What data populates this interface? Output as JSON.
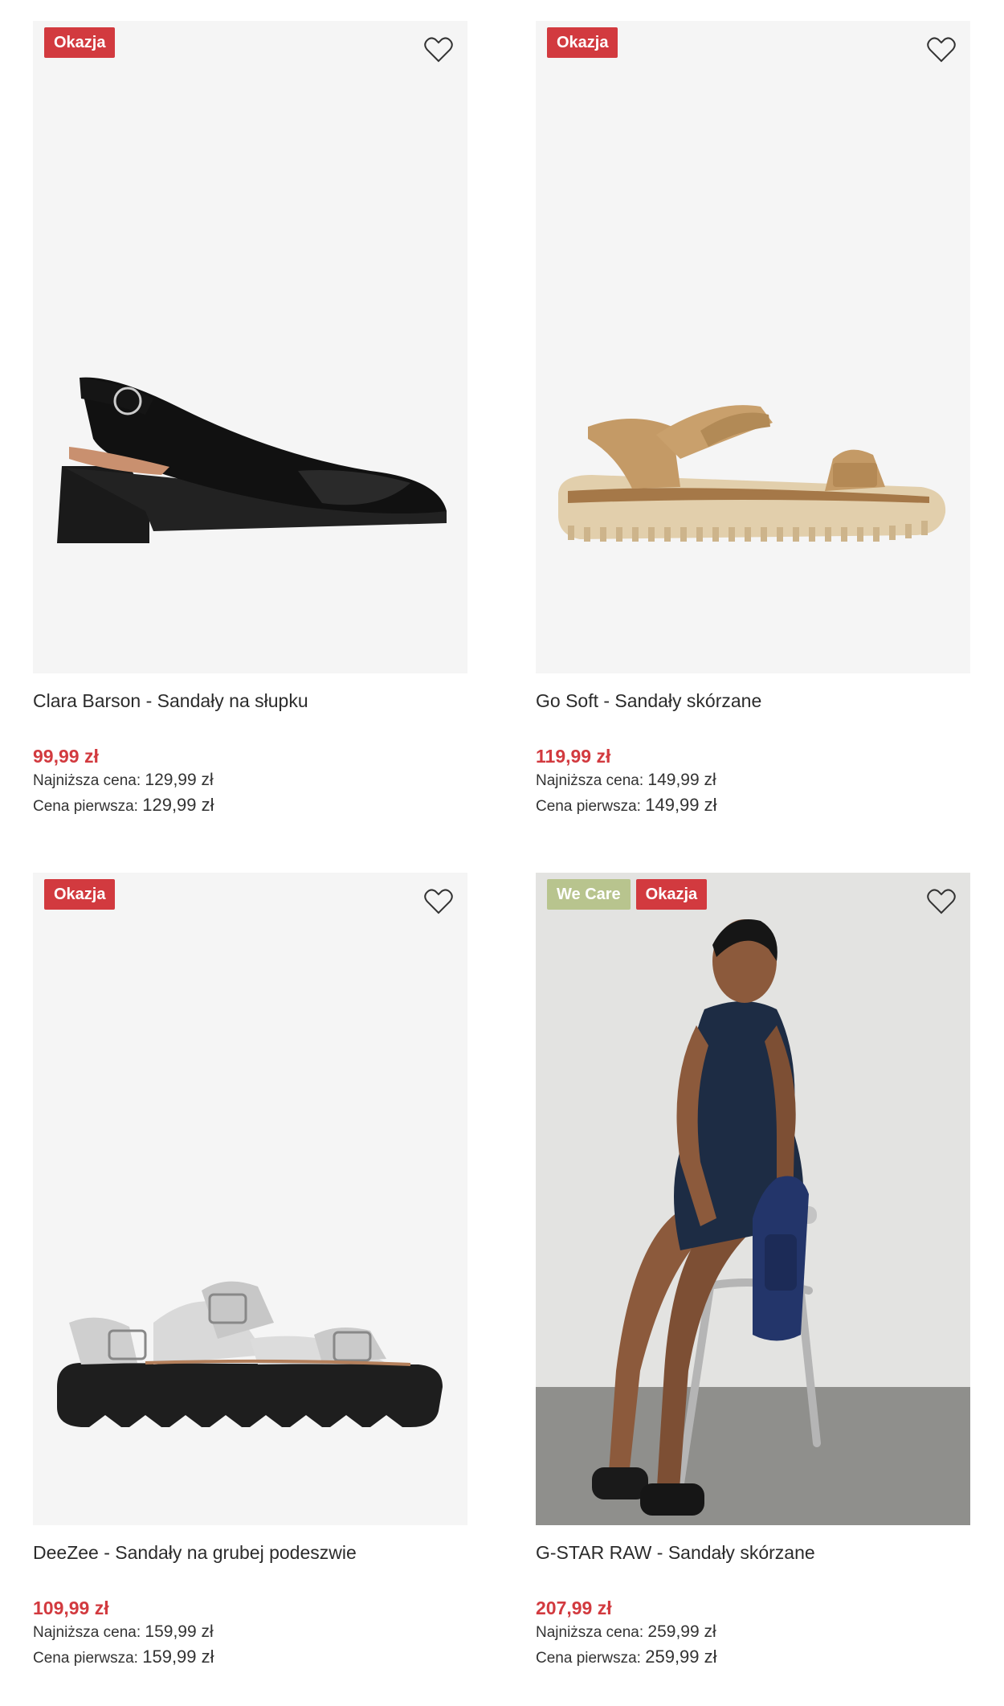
{
  "colors": {
    "deal_badge": "#d23a3f",
    "care_badge": "#b8c48e",
    "price": "#d23a3f",
    "image_bg": "#f5f5f5"
  },
  "products": [
    {
      "badges": [
        "Okazja"
      ],
      "title": "Clara Barson - Sandały na słupku",
      "price": "99,99 zł",
      "lowest_label": "Najniższa cena:",
      "lowest_value": "129,99 zł",
      "first_label": "Cena pierwsza:",
      "first_value": "129,99 zł",
      "icon": "heart-icon"
    },
    {
      "badges": [
        "Okazja"
      ],
      "title": "Go Soft - Sandały skórzane",
      "price": "119,99 zł",
      "lowest_label": "Najniższa cena:",
      "lowest_value": "149,99 zł",
      "first_label": "Cena pierwsza:",
      "first_value": "149,99 zł",
      "icon": "heart-icon"
    },
    {
      "badges": [
        "Okazja"
      ],
      "title": "DeeZee - Sandały na grubej podeszwie",
      "price": "109,99 zł",
      "lowest_label": "Najniższa cena:",
      "lowest_value": "159,99 zł",
      "first_label": "Cena pierwsza:",
      "first_value": "159,99 zł",
      "icon": "heart-icon"
    },
    {
      "badges": [
        "We Care",
        "Okazja"
      ],
      "title": "G-STAR RAW - Sandały skórzane",
      "price": "207,99 zł",
      "lowest_label": "Najniższa cena:",
      "lowest_value": "259,99 zł",
      "first_label": "Cena pierwsza:",
      "first_value": "259,99 zł",
      "icon": "heart-icon"
    }
  ]
}
